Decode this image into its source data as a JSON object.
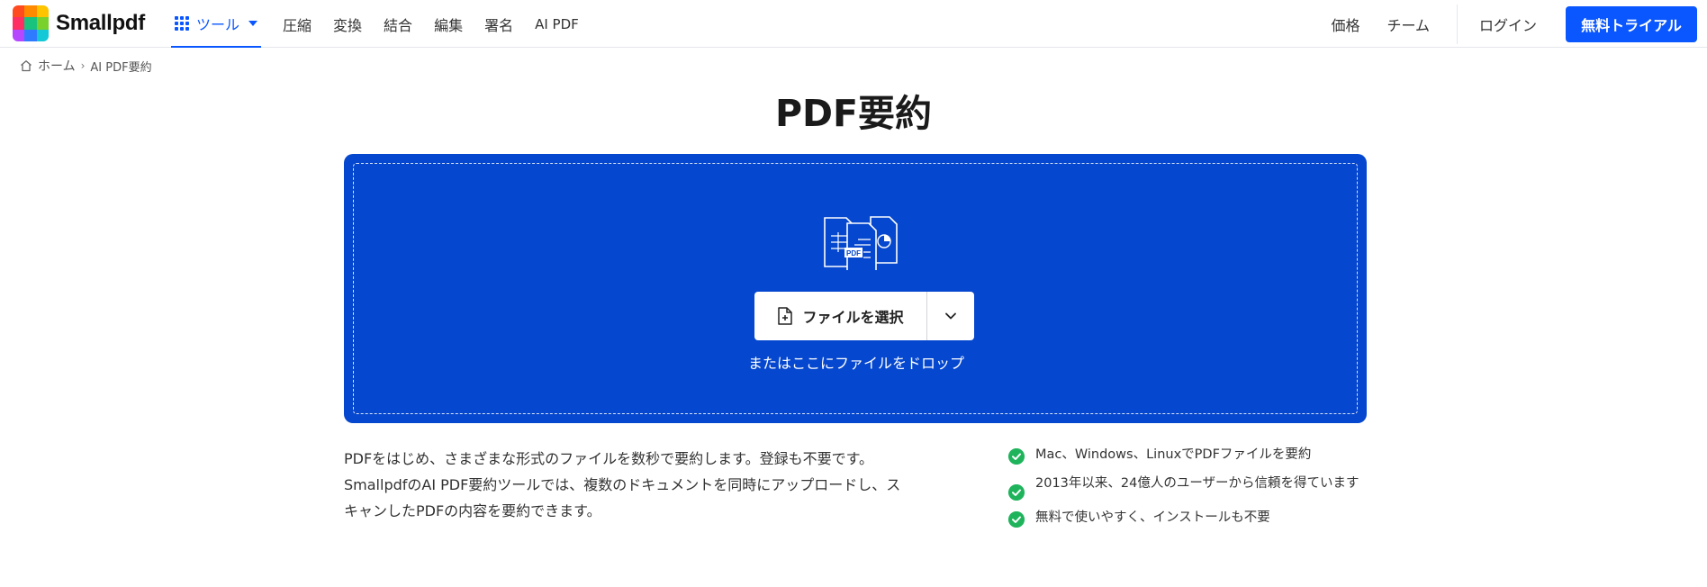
{
  "header": {
    "logo_text": "Smallpdf",
    "tools_label": "ツール",
    "nav": [
      "圧縮",
      "変換",
      "結合",
      "編集",
      "署名",
      "AI PDF"
    ],
    "pricing": "価格",
    "team": "チーム",
    "login": "ログイン",
    "trial": "無料トライアル"
  },
  "breadcrumb": {
    "home": "ホーム",
    "separator": "›",
    "current": "AI PDF要約"
  },
  "title": "PDF要約",
  "dropzone": {
    "file_badge": "PDF",
    "select_label": "ファイルを選択",
    "drop_hint": "またはここにファイルをドロップ"
  },
  "description": "PDFをはじめ、さまざまな形式のファイルを数秒で要約します。登録も不要です。 SmallpdfのAI PDF要約ツールでは、複数のドキュメントを同時にアップロードし、スキャンしたPDFの内容を要約できます。",
  "features": [
    "Mac、Windows、LinuxでPDFファイルを要約",
    "2013年以来、24億人のユーザーから信頼を得ています",
    "無料で使いやすく、インストールも不要"
  ],
  "colors": {
    "primary": "#0a57ff",
    "dropzone": "#0547ce",
    "check": "#1fb45c"
  }
}
